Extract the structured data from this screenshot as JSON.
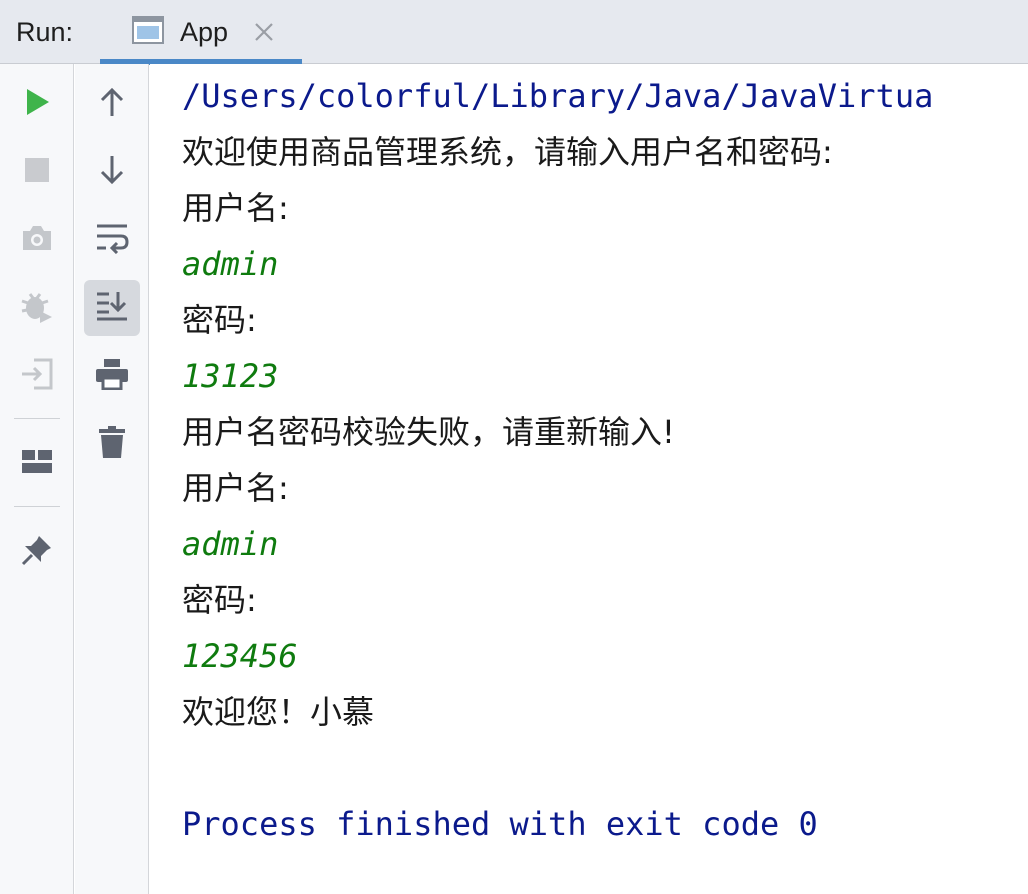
{
  "header": {
    "run_label": "Run:",
    "tab_label": "App",
    "tab_close_icon": "close-icon",
    "tab_icon": "console-window-icon"
  },
  "toolbar_left": {
    "icons": [
      "run-icon",
      "stop-icon",
      "camera-icon",
      "debug-icon",
      "login-icon",
      "layout-icon",
      "pin-icon"
    ]
  },
  "toolbar_right": {
    "icons": [
      "arrow-up-icon",
      "arrow-down-icon",
      "soft-wrap-icon",
      "scroll-to-end-icon",
      "print-icon",
      "trash-icon"
    ]
  },
  "console": {
    "lines": [
      {
        "text": "/Users/colorful/Library/Java/JavaVirtua",
        "kind": "sys"
      },
      {
        "text": "欢迎使用商品管理系统，请输入用户名和密码:",
        "kind": "out"
      },
      {
        "text": "用户名:",
        "kind": "out"
      },
      {
        "text": "admin",
        "kind": "input"
      },
      {
        "text": "密码:",
        "kind": "out"
      },
      {
        "text": "13123",
        "kind": "input"
      },
      {
        "text": "用户名密码校验失败，请重新输入!",
        "kind": "out"
      },
      {
        "text": "用户名:",
        "kind": "out"
      },
      {
        "text": "admin",
        "kind": "input"
      },
      {
        "text": "密码:",
        "kind": "out"
      },
      {
        "text": "123456",
        "kind": "input"
      },
      {
        "text": "欢迎您！小慕",
        "kind": "out"
      },
      {
        "text": "",
        "kind": "out"
      },
      {
        "text": "Process finished with exit code 0",
        "kind": "sys"
      }
    ]
  },
  "colors": {
    "system_text": "#0b1a8c",
    "user_input": "#0f7b0f",
    "run_green": "#3fb44b",
    "tab_underline": "#4a88c7"
  }
}
